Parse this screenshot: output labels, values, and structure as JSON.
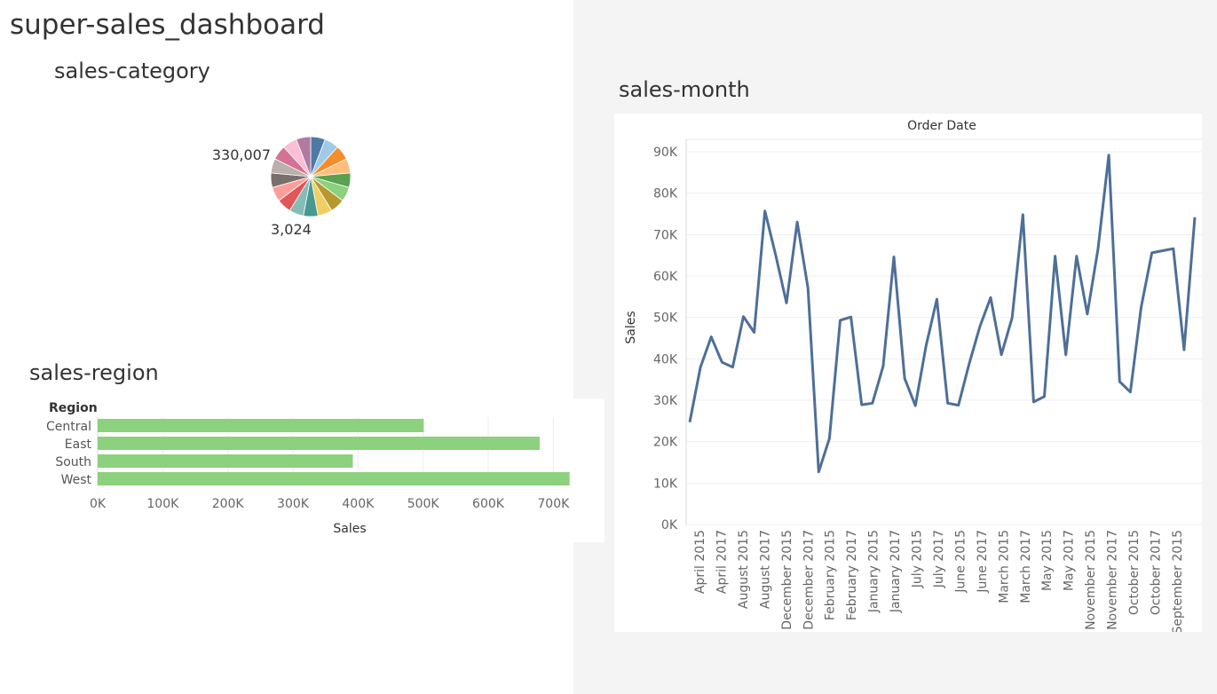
{
  "dashboard": {
    "title": "super-sales_dashboard"
  },
  "sheets": {
    "category": {
      "title": "sales-category"
    },
    "region": {
      "title": "sales-region"
    },
    "month": {
      "title": "sales-month"
    }
  },
  "chart_data": [
    {
      "type": "pie",
      "title": "sales-category",
      "slices": [
        {
          "color": "#4e79a7",
          "value": 330007
        },
        {
          "color": "#a0cbe8",
          "value": 330007
        },
        {
          "color": "#f28e2b",
          "value": 330007
        },
        {
          "color": "#ffbe7d",
          "value": 330007
        },
        {
          "color": "#59a14f",
          "value": 330007
        },
        {
          "color": "#8cd17d",
          "value": 330007
        },
        {
          "color": "#b6992d",
          "value": 330007
        },
        {
          "color": "#f1ce63",
          "value": 330007
        },
        {
          "color": "#499894",
          "value": 330007
        },
        {
          "color": "#86bcb6",
          "value": 330007
        },
        {
          "color": "#e15759",
          "value": 330007
        },
        {
          "color": "#ff9d9a",
          "value": 330007
        },
        {
          "color": "#79706e",
          "value": 330007
        },
        {
          "color": "#bab0ac",
          "value": 330007
        },
        {
          "color": "#d37295",
          "value": 330007
        },
        {
          "color": "#fabfd2",
          "value": 330007
        },
        {
          "color": "#b07aa1",
          "value": 330007
        }
      ],
      "labels": [
        "330,007",
        "3,024"
      ]
    },
    {
      "type": "bar",
      "orientation": "horizontal",
      "title": "sales-region",
      "row_header": "Region",
      "categories": [
        "Central",
        "East",
        "South",
        "West"
      ],
      "values": [
        501000,
        679000,
        392000,
        725000
      ],
      "xlabel": "Sales",
      "xlim": [
        0,
        750000
      ],
      "ticks": [
        0,
        100000,
        200000,
        300000,
        400000,
        500000,
        600000,
        700000
      ],
      "tick_labels": [
        "0K",
        "100K",
        "200K",
        "300K",
        "400K",
        "500K",
        "600K",
        "700K"
      ],
      "grid": true,
      "color": "#8cd17d"
    },
    {
      "type": "line",
      "title": "sales-month",
      "header": "Order Date",
      "ylabel": "Sales",
      "ylim": [
        0,
        93000
      ],
      "yticks": [
        0,
        10000,
        20000,
        30000,
        40000,
        50000,
        60000,
        70000,
        80000,
        90000
      ],
      "ytick_labels": [
        "0K",
        "10K",
        "20K",
        "30K",
        "40K",
        "50K",
        "60K",
        "70K",
        "80K",
        "90K"
      ],
      "x_labels": [
        "April 2015",
        "April 2017",
        "August 2015",
        "August 2017",
        "December 2015",
        "December 2017",
        "February 2015",
        "February 2017",
        "January 2015",
        "January 2017",
        "July 2015",
        "July 2017",
        "June 2015",
        "June 2017",
        "March 2015",
        "March 2017",
        "May 2015",
        "May 2017",
        "November 2015",
        "November 2017",
        "October 2015",
        "October 2017",
        "September 2015"
      ],
      "values": [
        24700,
        38000,
        45300,
        39200,
        38000,
        50200,
        46400,
        75700,
        65000,
        53500,
        73000,
        57100,
        12700,
        20800,
        49300,
        50100,
        28900,
        29300,
        38200,
        64600,
        35300,
        28700,
        43200,
        54400,
        29300,
        28800,
        38800,
        47800,
        54800,
        41000,
        49900,
        74800,
        29600,
        30900,
        64800,
        41000,
        64800,
        50800,
        66600,
        89200,
        34500,
        32000,
        52400,
        65600,
        66100,
        66600,
        42200,
        74200
      ],
      "color": "#4e6f97",
      "grid": true
    }
  ]
}
